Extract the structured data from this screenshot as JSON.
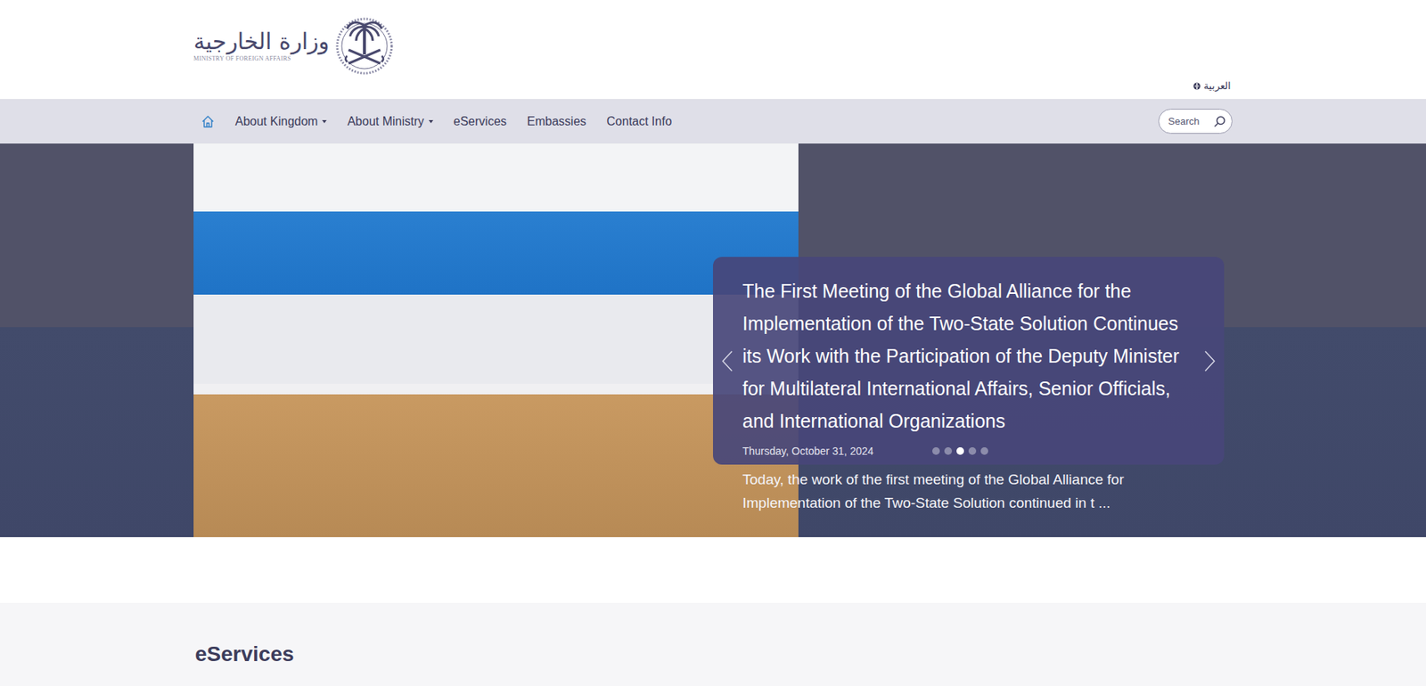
{
  "logo": {
    "arabic": "وزارة الخارجية",
    "english": "MINISTRY OF FOREIGN AFFAIRS"
  },
  "language": {
    "label": "العربية"
  },
  "nav": {
    "home": {
      "selected": true
    },
    "items": [
      {
        "label": "About Kingdom",
        "dropdown": true
      },
      {
        "label": "About Ministry",
        "dropdown": true
      },
      {
        "label": "eServices",
        "dropdown": false
      },
      {
        "label": "Embassies",
        "dropdown": false
      },
      {
        "label": "Contact Info",
        "dropdown": false
      }
    ]
  },
  "search": {
    "placeholder": "Search"
  },
  "slider": {
    "title": "The First Meeting of the Global Alliance for the Implementation of the Two-State Solution Continues its Work with the Participation of the Deputy Minister for Multilateral International Affairs, Senior Officials, and International Organizations",
    "date": "Thursday, October 31, 2024",
    "summary": "Today, the work of the first meeting of the Global Alliance for Implementation of the Two-State Solution continued in t ...",
    "slides": [
      {
        "selected": false
      },
      {
        "selected": false
      },
      {
        "selected": true
      },
      {
        "selected": false
      },
      {
        "selected": false
      }
    ]
  },
  "sections": [
    {
      "title": "eServices"
    }
  ]
}
